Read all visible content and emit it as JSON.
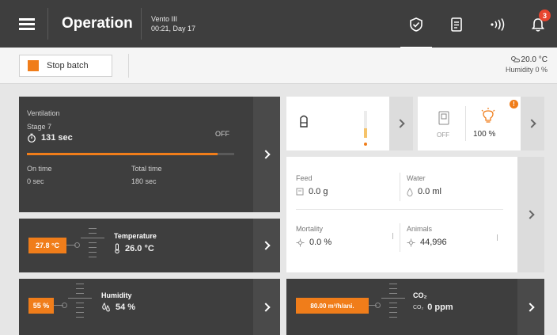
{
  "header": {
    "title": "Operation",
    "device_name": "Vento III",
    "device_time": "00:21, Day 17",
    "notification_count": "3"
  },
  "subbar": {
    "stop_batch_label": "Stop batch",
    "outside_temp": "20.0 °C",
    "outside_humidity": "Humidity 0 %"
  },
  "ventilation": {
    "title": "Ventilation",
    "stage": "Stage 7",
    "time": "131 sec",
    "state": "OFF",
    "progress": 0.92,
    "on_time_label": "On time",
    "on_time_value": "0 sec",
    "total_time_label": "Total time",
    "total_time_value": "180 sec"
  },
  "temperature": {
    "setpoint": "27.8 °C",
    "label": "Temperature",
    "value": "26.0 °C"
  },
  "humidity": {
    "setpoint": "55 %",
    "label": "Humidity",
    "value": "54 %"
  },
  "co2": {
    "setpoint": "80.00 m³/h/ani.",
    "label": "CO₂",
    "value": "0 ppm"
  },
  "light": {
    "state": "OFF",
    "percent": "100 %",
    "alert_count": "!"
  },
  "stats": {
    "feed_label": "Feed",
    "feed_value": "0.0 g",
    "water_label": "Water",
    "water_value": "0.0 ml",
    "mortality_label": "Mortality",
    "mortality_value": "0.0 %",
    "animals_label": "Animals",
    "animals_value": "44,996"
  },
  "colors": {
    "accent": "#f07d1a",
    "dark_panel": "#3e3e3e",
    "alert": "#e8452f"
  }
}
